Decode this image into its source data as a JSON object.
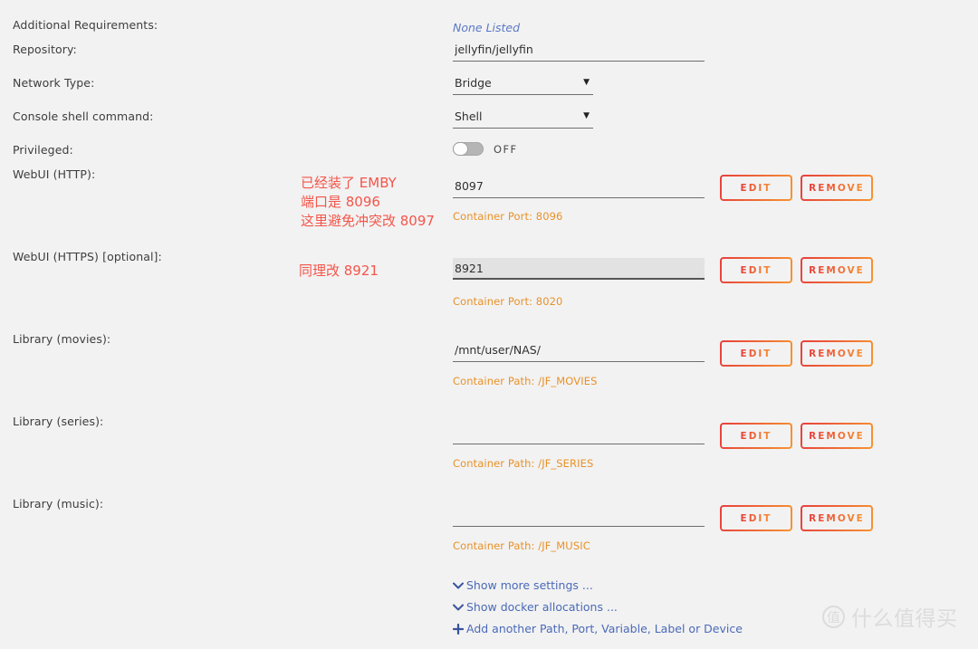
{
  "page": {
    "background": "#f2f2f2",
    "accent_orange": "#e8922a",
    "accent_red": "#e8403c",
    "link_blue": "#4a69b8",
    "annotation_red": "#f4554a"
  },
  "rows": {
    "additional_requirements": {
      "label": "Additional Requirements:",
      "value": "None Listed"
    },
    "repository": {
      "label": "Repository:",
      "value": "jellyfin/jellyfin",
      "placeholder": "repository"
    },
    "network_type": {
      "label": "Network Type:",
      "value": "Bridge",
      "caret": "▼"
    },
    "console_shell": {
      "label": "Console shell command:",
      "value": "Shell",
      "caret": "▼"
    },
    "privileged": {
      "label": "Privileged:",
      "state": "OFF"
    },
    "webui_http": {
      "label": "WebUI (HTTP):",
      "value": "8097",
      "hint": "Container Port: 8096",
      "edit_label": "EDIT",
      "remove_label": "REMOVE"
    },
    "webui_https": {
      "label": "WebUI (HTTPS) [optional]:",
      "value": "8921",
      "hint": "Container Port: 8020",
      "edit_label": "EDIT",
      "remove_label": "REMOVE"
    },
    "library_movies": {
      "label": "Library (movies):",
      "value": "/mnt/user/NAS/",
      "hint": "Container Path: /JF_MOVIES",
      "edit_label": "EDIT",
      "remove_label": "REMOVE"
    },
    "library_series": {
      "label": "Library (series):",
      "value": "",
      "hint": "Container Path: /JF_SERIES",
      "edit_label": "EDIT",
      "remove_label": "REMOVE"
    },
    "library_music": {
      "label": "Library (music):",
      "value": "",
      "hint": "Container Path: /JF_MUSIC",
      "edit_label": "EDIT",
      "remove_label": "REMOVE"
    }
  },
  "annotations": {
    "http_note_line1": "已经装了 EMBY",
    "http_note_line2": "端口是 8096",
    "http_note_line3": "这里避免冲突改 8097",
    "https_note": "同理改 8921"
  },
  "links": [
    {
      "icon": "chevron-down-icon",
      "label": "Show more settings ..."
    },
    {
      "icon": "chevron-down-icon",
      "label": "Show docker allocations ..."
    },
    {
      "icon": "plus-icon",
      "label": "Add another Path, Port, Variable, Label or Device"
    }
  ],
  "watermark": {
    "badge": "值",
    "text": "什么值得买"
  }
}
